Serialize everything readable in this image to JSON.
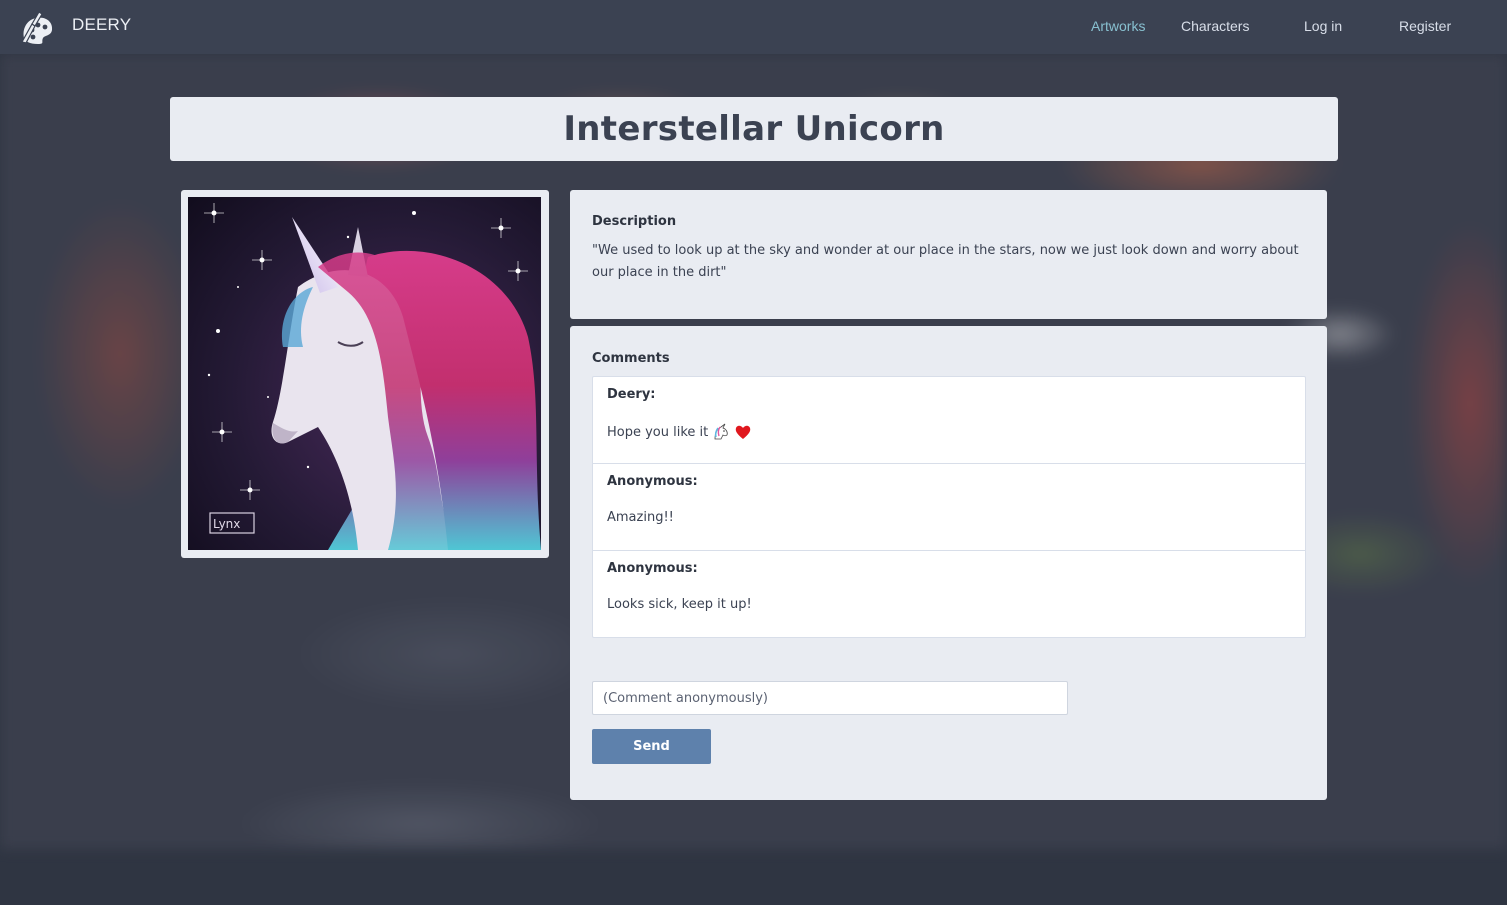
{
  "navbar": {
    "brand": "DEERY",
    "links": [
      {
        "label": "Artworks",
        "active": true
      },
      {
        "label": "Characters",
        "active": false
      },
      {
        "label": "Log in",
        "active": false
      },
      {
        "label": "Register",
        "active": false
      }
    ]
  },
  "artwork": {
    "title": "Interstellar Unicorn",
    "signature": "Lynx"
  },
  "description": {
    "heading": "Description",
    "text": "\"We used to look up at the sky and wonder at our place in the stars, now we just look down and worry about our place in the dirt\""
  },
  "comments": {
    "heading": "Comments",
    "items": [
      {
        "author": "Deery:",
        "text": "Hope you like it",
        "emojis": [
          "unicorn-emoji",
          "heart-emoji"
        ]
      },
      {
        "author": "Anonymous:",
        "text": "Amazing!!"
      },
      {
        "author": "Anonymous:",
        "text": "Looks sick, keep it up!"
      }
    ],
    "input": {
      "value": "",
      "placeholder": "(Comment anonymously)"
    },
    "send_label": "Send"
  },
  "colors": {
    "navbar": "#3b4252",
    "active_link": "#88c0d0",
    "card": "#e9ecf2",
    "button": "#5e81ac"
  }
}
